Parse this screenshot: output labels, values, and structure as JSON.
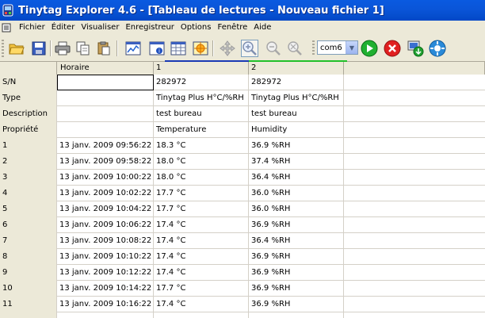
{
  "window": {
    "title": "Tinytag Explorer 4.6 - [Tableau de lectures - Nouveau fichier 1]"
  },
  "menu": {
    "items": [
      {
        "label": "Fichier"
      },
      {
        "label": "Éditer"
      },
      {
        "label": "Visualiser"
      },
      {
        "label": "Enregistreur"
      },
      {
        "label": "Options"
      },
      {
        "label": "Fenêtre"
      },
      {
        "label": "Aide"
      }
    ]
  },
  "toolbar": {
    "buttons": [
      {
        "icon": "open-folder-icon"
      },
      {
        "icon": "save-icon"
      },
      {
        "icon": "print-icon"
      },
      {
        "icon": "copy-icon"
      },
      {
        "icon": "paste-icon"
      },
      {
        "icon": "graph-view-icon"
      },
      {
        "icon": "summary-view-icon"
      },
      {
        "icon": "table-view-icon"
      },
      {
        "icon": "overview-icon"
      },
      {
        "icon": "pan-icon"
      },
      {
        "icon": "zoom-in-icon"
      },
      {
        "icon": "zoom-out-icon"
      },
      {
        "icon": "zoom-reset-icon"
      },
      {
        "icon": "start-logger-icon"
      },
      {
        "icon": "stop-logger-icon"
      },
      {
        "icon": "download-logger-icon"
      },
      {
        "icon": "logger-status-icon"
      }
    ],
    "port": {
      "value": "com6"
    }
  },
  "grid": {
    "headers": [
      "",
      "Horaire",
      "1",
      "2",
      ""
    ],
    "meta_rows": [
      {
        "label": "S/N",
        "time": "",
        "ch1": "282972",
        "ch2": "282972"
      },
      {
        "label": "Type",
        "time": "",
        "ch1": "Tinytag Plus H°C/%RH",
        "ch2": "Tinytag Plus H°C/%RH"
      },
      {
        "label": "Description",
        "time": "",
        "ch1": "test bureau",
        "ch2": "test bureau"
      },
      {
        "label": "Propriété",
        "time": "",
        "ch1": "Temperature",
        "ch2": "Humidity"
      }
    ],
    "data_rows": [
      {
        "index": "1",
        "time": "13 janv. 2009 09:56:22",
        "ch1": "18.3 °C",
        "ch2": "36.9 %RH"
      },
      {
        "index": "2",
        "time": "13 janv. 2009 09:58:22",
        "ch1": "18.0 °C",
        "ch2": "37.4 %RH"
      },
      {
        "index": "3",
        "time": "13 janv. 2009 10:00:22",
        "ch1": "18.0 °C",
        "ch2": "36.4 %RH"
      },
      {
        "index": "4",
        "time": "13 janv. 2009 10:02:22",
        "ch1": "17.7 °C",
        "ch2": "36.0 %RH"
      },
      {
        "index": "5",
        "time": "13 janv. 2009 10:04:22",
        "ch1": "17.7 °C",
        "ch2": "36.0 %RH"
      },
      {
        "index": "6",
        "time": "13 janv. 2009 10:06:22",
        "ch1": "17.4 °C",
        "ch2": "36.9 %RH"
      },
      {
        "index": "7",
        "time": "13 janv. 2009 10:08:22",
        "ch1": "17.4 °C",
        "ch2": "36.4 %RH"
      },
      {
        "index": "8",
        "time": "13 janv. 2009 10:10:22",
        "ch1": "17.4 °C",
        "ch2": "36.9 %RH"
      },
      {
        "index": "9",
        "time": "13 janv. 2009 10:12:22",
        "ch1": "17.4 °C",
        "ch2": "36.9 %RH"
      },
      {
        "index": "10",
        "time": "13 janv. 2009 10:14:22",
        "ch1": "17.7 °C",
        "ch2": "36.9 %RH"
      },
      {
        "index": "11",
        "time": "13 janv. 2009 10:16:22",
        "ch1": "17.4 °C",
        "ch2": "36.9 %RH"
      }
    ]
  },
  "colors": {
    "titlebar": "#0a55d8",
    "chrome": "#ece9d8",
    "channel1_marker": "#1a3ab5",
    "channel2_marker": "#22c02a"
  }
}
